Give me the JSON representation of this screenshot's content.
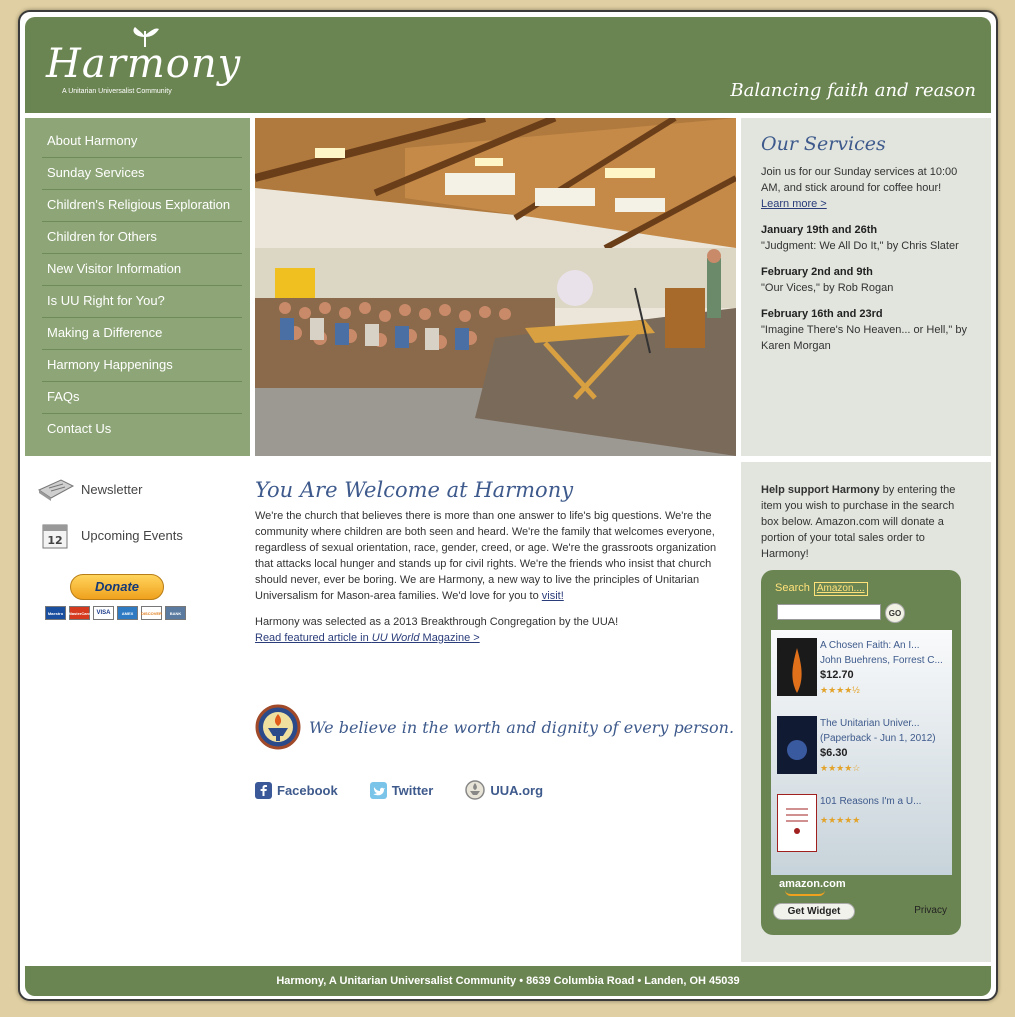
{
  "header": {
    "logo_text": "Harmony",
    "logo_subtitle": "A Unitarian Universalist Community",
    "tagline": "Balancing faith and reason"
  },
  "nav": {
    "items": [
      "About Harmony",
      "Sunday Services",
      "Children's Religious Exploration",
      "Children for Others",
      "New Visitor Information",
      "Is UU Right for You?",
      "Making a Difference",
      "Harmony Happenings",
      "FAQs",
      "Contact Us"
    ]
  },
  "services": {
    "title": "Our Services",
    "intro": "Join us for our Sunday services at 10:00 AM, and stick around for coffee hour!",
    "learn_more": "Learn more >",
    "schedule": [
      {
        "dates": "January 19th and 26th",
        "sermon": "\"Judgment: We All Do It,\" by Chris Slater"
      },
      {
        "dates": "February 2nd and 9th",
        "sermon": "\"Our Vices,\" by Rob Rogan"
      },
      {
        "dates": "February 16th and 23rd",
        "sermon": "\"Imagine There's No Heaven... or Hell,\" by Karen Morgan"
      }
    ]
  },
  "sidebar": {
    "newsletter": "Newsletter",
    "events": "Upcoming Events",
    "donate": "Donate",
    "calendar_day": "12",
    "cards": [
      "Maestro",
      "MasterCard",
      "VISA",
      "AMEX",
      "DISCOVER",
      "BANK"
    ]
  },
  "main": {
    "title": "You Are Welcome at Harmony",
    "body": "We're the church that believes there is more than one answer to life's big questions. We're the community where children are both seen and heard. We're the family that welcomes everyone, regardless of sexual orientation, race, gender, creed, or age. We're the grassroots organization that attacks local hunger and stands up for civil rights. We're the friends who insist that church should never, ever be boring. We are Harmony, a new way to live the principles of Unitarian Universalism for Mason-area families. We'd love for you to ",
    "visit_link": "visit!",
    "breakthrough": "Harmony was selected as a 2013 Breakthrough Congregation by the UUA!",
    "article_pre": "Read featured article in ",
    "article_em": "UU World",
    "article_post": " Magazine >",
    "belief": "We believe in the worth and dignity of every person."
  },
  "social": {
    "facebook": "Facebook",
    "twitter": "Twitter",
    "uua": "UUA.org"
  },
  "support": {
    "bold": "Help support Harmony",
    "text": " by entering the item you wish to purchase in the search box below. Amazon.com will donate a portion of your total sales order to Harmony!"
  },
  "amazon_widget": {
    "search_label": "Search",
    "search_scope": "Amazon....",
    "go": "GO",
    "items": [
      {
        "title": "A Chosen Faith: An I...",
        "author": "John Buehrens, Forrest C...",
        "price": "$12.70",
        "stars": "★★★★½",
        "rating": 4.5
      },
      {
        "title": "The Unitarian Univer...",
        "author": "(Paperback - Jun 1, 2012)",
        "price": "$6.30",
        "stars": "★★★★☆",
        "rating": 4
      },
      {
        "title": "101 Reasons I'm a U...",
        "author": "",
        "price": "",
        "stars": "★★★★★",
        "rating": 5
      }
    ],
    "amazon_logo": "amazon.com",
    "get_widget": "Get Widget",
    "privacy": "Privacy"
  },
  "footer": {
    "text": "Harmony, A Unitarian Universalist Community • 8639 Columbia Road • Landen, OH 45039"
  },
  "colors": {
    "header_green": "#6b8552",
    "nav_green": "#8ea677",
    "panel_gray": "#e1e5de",
    "title_blue": "#3e5a8c",
    "page_bg": "#e0cfa2"
  }
}
